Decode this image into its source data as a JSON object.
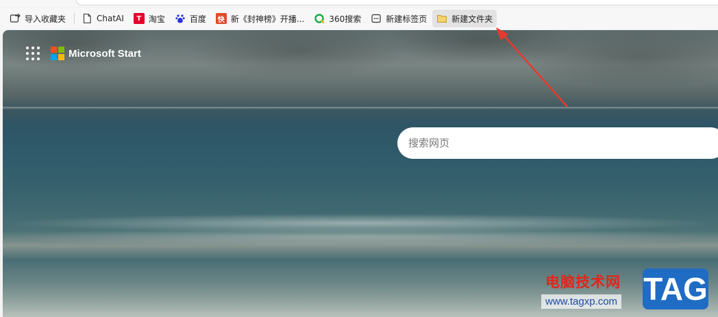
{
  "bookmarks": [
    {
      "label": "导入收藏夹",
      "icon": "import-favorites-icon"
    },
    {
      "label": "ChatAI",
      "icon": "page-icon"
    },
    {
      "label": "淘宝",
      "icon": "taobao-icon"
    },
    {
      "label": "百度",
      "icon": "baidu-paw-icon"
    },
    {
      "label": "新《封神榜》开播...",
      "icon": "kuai-icon"
    },
    {
      "label": "360搜索",
      "icon": "360-search-icon"
    },
    {
      "label": "新建标签页",
      "icon": "new-tab-icon"
    },
    {
      "label": "新建文件夹",
      "icon": "folder-icon"
    }
  ],
  "icon_glyphs": {
    "taobao": "T",
    "kuai": "快"
  },
  "page": {
    "brand": "Microsoft Start",
    "search_placeholder": "搜索网页"
  },
  "watermark": {
    "site_name": "电脑技术网",
    "url": "www.tagxp.com",
    "tag": "TAG"
  },
  "colors": {
    "arrow": "#e53a2e",
    "taobao": "#e4002b",
    "kuai": "#e04a2a",
    "baidu": "#2932e1",
    "folder": "#f5c542",
    "ms_red": "#f25022",
    "ms_green": "#7fba00",
    "ms_blue": "#00a4ef",
    "ms_yellow": "#ffb900"
  }
}
